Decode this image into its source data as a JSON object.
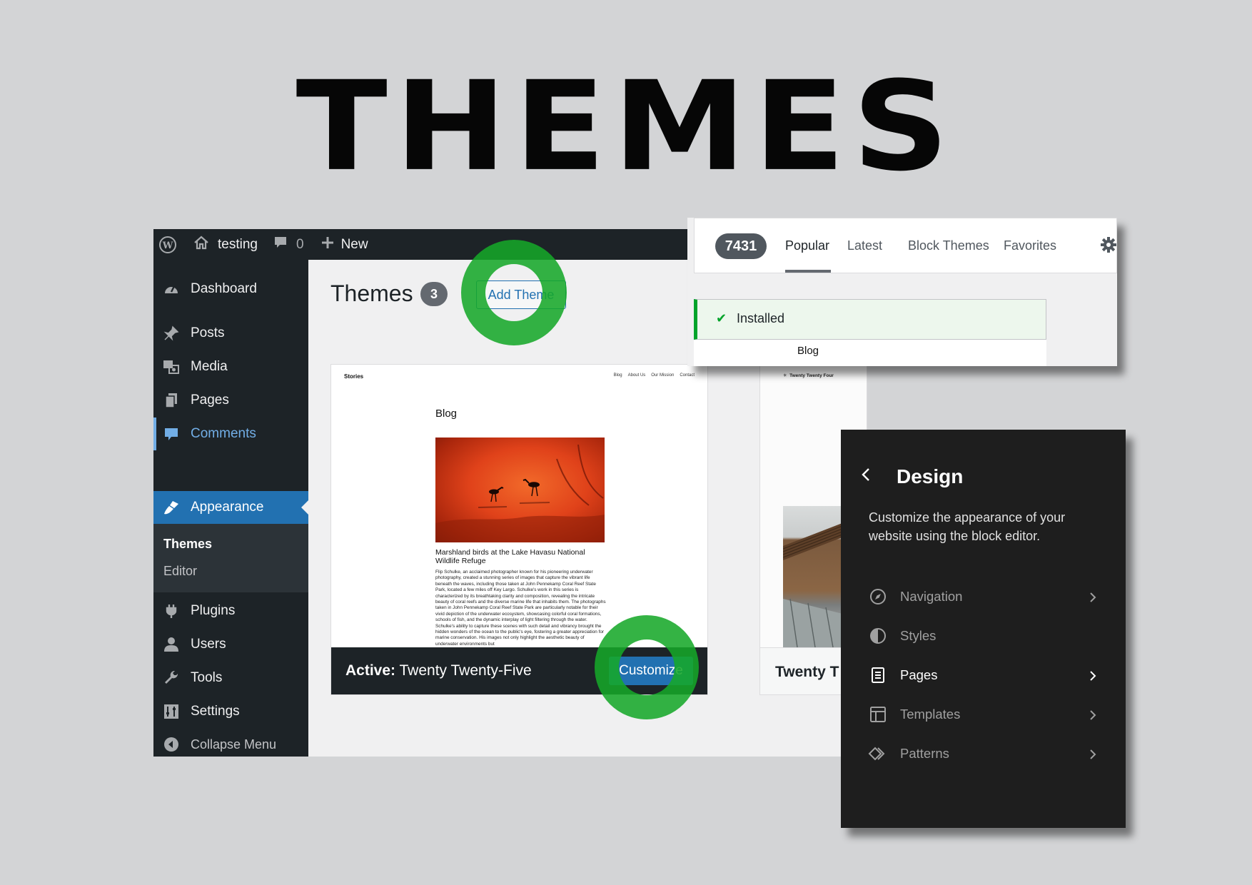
{
  "headline": "THEMES",
  "admin_bar": {
    "site_name": "testing",
    "comment_count": "0",
    "new_label": "New"
  },
  "sidebar": {
    "items": [
      {
        "label": "Dashboard",
        "icon": "dashboard-icon"
      },
      {
        "label": "Posts",
        "icon": "pin-icon"
      },
      {
        "label": "Media",
        "icon": "media-icon"
      },
      {
        "label": "Pages",
        "icon": "pages-icon"
      },
      {
        "label": "Comments",
        "icon": "comment-icon"
      },
      {
        "label": "Appearance",
        "icon": "brush-icon"
      },
      {
        "label": "Plugins",
        "icon": "plug-icon"
      },
      {
        "label": "Users",
        "icon": "user-icon"
      },
      {
        "label": "Tools",
        "icon": "wrench-icon"
      },
      {
        "label": "Settings",
        "icon": "settings-icon"
      },
      {
        "label": "Collapse Menu",
        "icon": "collapse-icon"
      }
    ],
    "submenu": [
      {
        "label": "Themes"
      },
      {
        "label": "Editor"
      }
    ]
  },
  "main": {
    "title": "Themes",
    "count": "3",
    "add_button": "Add Theme",
    "active_card": {
      "preview": {
        "site_title": "Stories",
        "nav": [
          "Blog",
          "About Us",
          "Our Mission",
          "Contact"
        ],
        "heading": "Blog",
        "caption": "Marshland birds at the Lake Havasu National Wildlife Refuge",
        "body": "Flip Schulke, an acclaimed photographer known for his pioneering underwater photography, created a stunning series of images that capture the vibrant life beneath the waves, including those taken at John Pennekamp Coral Reef State Park, located a few miles off Key Largo. Schulke's work in this series is characterized by its breathtaking clarity and composition, revealing the intricate beauty of coral reefs and the diverse marine life that inhabits them. The photographs taken in John Pennekamp Coral Reef State Park are particularly notable for their vivid depiction of the underwater ecosystem, showcasing colorful coral formations, schools of fish, and the dynamic interplay of light filtering through the water. Schulke's ability to capture these scenes with such detail and vibrancy brought the hidden wonders of the ocean to the public's eye, fostering a greater appreciation for marine conservation. His images not only highlight the aesthetic beauty of underwater environments but"
      },
      "active_prefix": "Active:",
      "active_name": "Twenty Twenty-Five",
      "customize_button": "Customize"
    },
    "second_card": {
      "site_title": "Twenty Twenty Four",
      "name": "Twenty T"
    }
  },
  "filter_bar": {
    "count": "7431",
    "tabs": [
      "Popular",
      "Latest",
      "Block Themes",
      "Favorites"
    ],
    "current_tab": "Popular",
    "notice": "Installed",
    "strip_text": "Blog"
  },
  "design_panel": {
    "title": "Design",
    "description": "Customize the appearance of your website using the block editor.",
    "items": [
      {
        "label": "Navigation",
        "icon": "compass-icon"
      },
      {
        "label": "Styles",
        "icon": "half-circle-icon"
      },
      {
        "label": "Pages",
        "icon": "page-icon"
      },
      {
        "label": "Templates",
        "icon": "layout-icon"
      },
      {
        "label": "Patterns",
        "icon": "diamond-icon"
      }
    ]
  },
  "colors": {
    "admin_dark": "#1d2327",
    "wp_blue": "#2271b1",
    "comments_blue": "#72aee6",
    "highlight_green": "#16a828",
    "page_bg": "#d3d4d6",
    "design_panel_bg": "#1e1e1e"
  }
}
